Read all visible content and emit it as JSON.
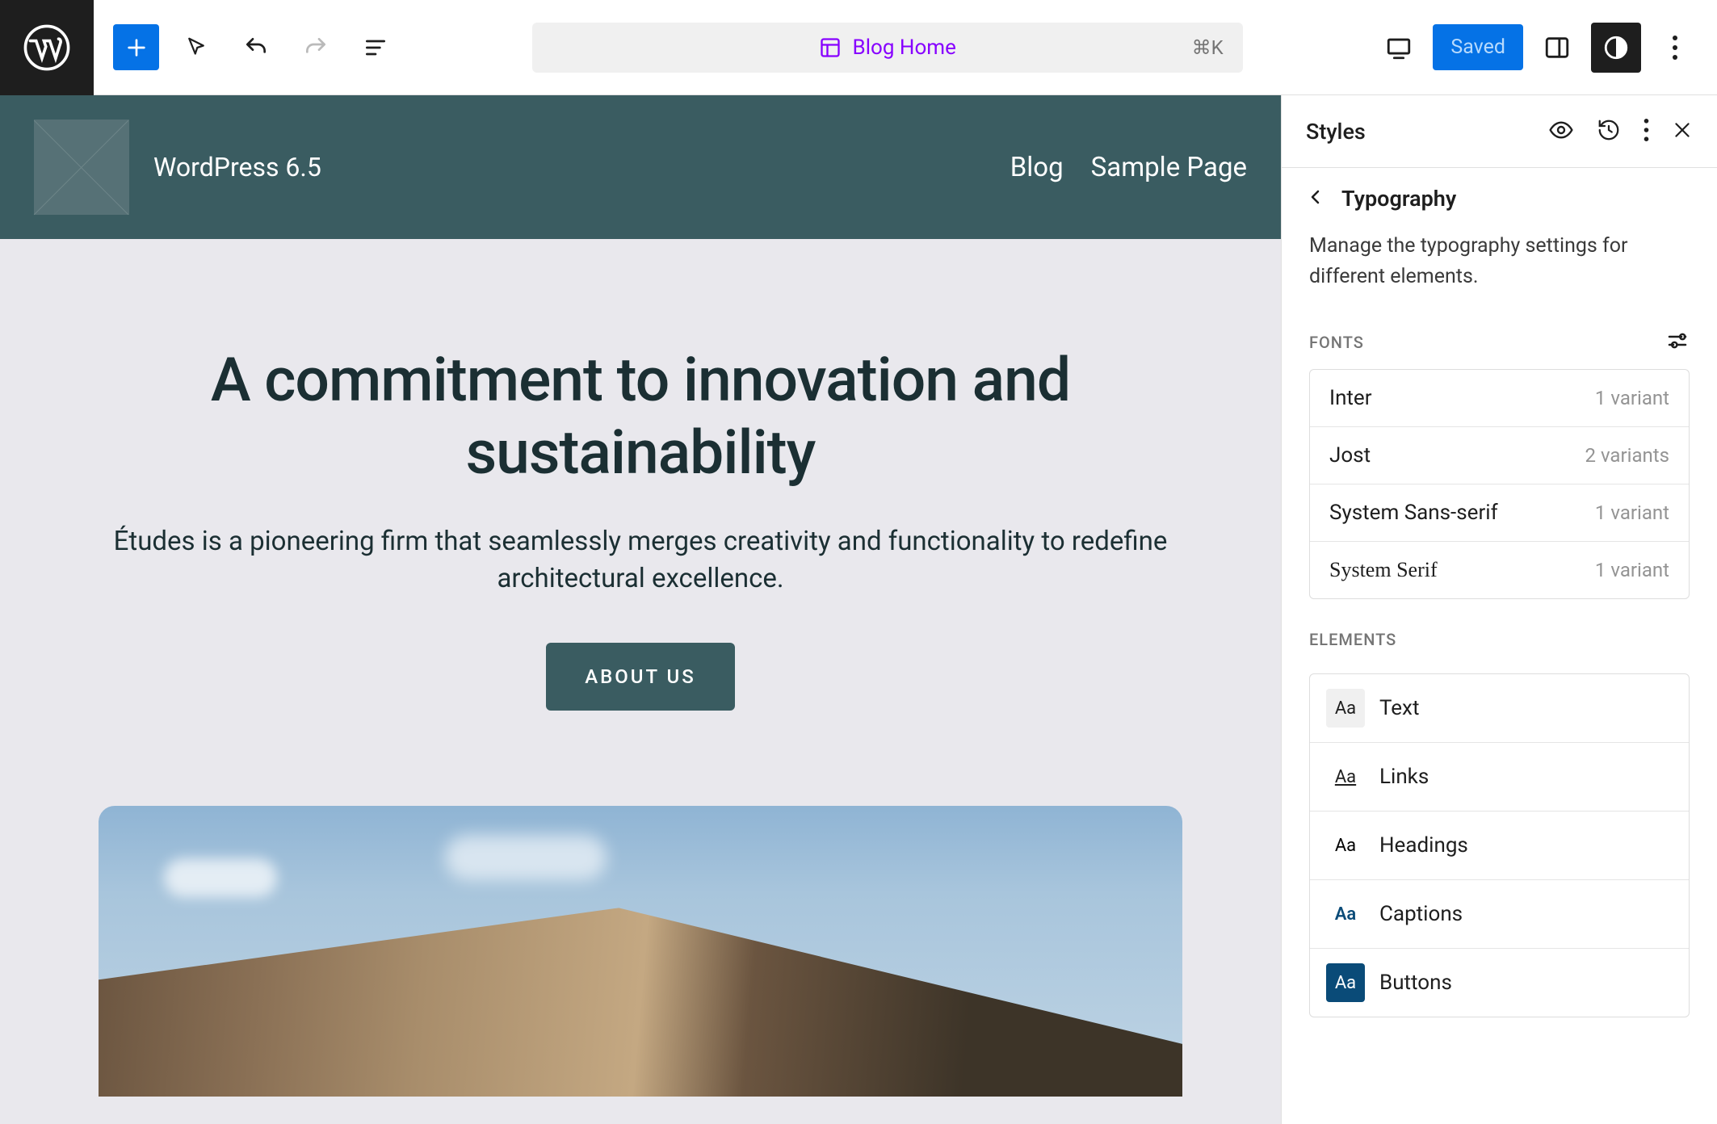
{
  "topbar": {
    "template_label": "Blog Home",
    "shortcut": "⌘K",
    "saved_label": "Saved"
  },
  "site": {
    "title": "WordPress 6.5",
    "nav": [
      "Blog",
      "Sample Page"
    ]
  },
  "hero": {
    "heading": "A commitment to innovation and sustainability",
    "subtext": "Études is a pioneering firm that seamlessly merges creativity and functionality to redefine architectural excellence.",
    "button": "ABOUT US"
  },
  "sidebar": {
    "title": "Styles",
    "crumb": "Typography",
    "desc": "Manage the typography settings for different elements.",
    "fonts_label": "FONTS",
    "fonts": [
      {
        "name": "Inter",
        "variants": "1 variant"
      },
      {
        "name": "Jost",
        "variants": "2 variants"
      },
      {
        "name": "System Sans-serif",
        "variants": "1 variant"
      },
      {
        "name": "System Serif",
        "variants": "1 variant"
      }
    ],
    "elements_label": "ELEMENTS",
    "elements": [
      {
        "label": "Text",
        "icon_style": "light"
      },
      {
        "label": "Links",
        "icon_style": "underline"
      },
      {
        "label": "Headings",
        "icon_style": "plain"
      },
      {
        "label": "Captions",
        "icon_style": "blue"
      },
      {
        "label": "Buttons",
        "icon_style": "dark"
      }
    ]
  }
}
